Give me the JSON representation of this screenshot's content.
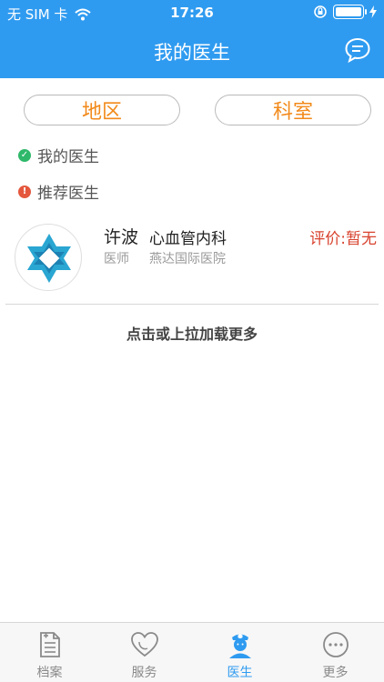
{
  "status": {
    "carrier": "无 SIM 卡",
    "time": "17:26"
  },
  "nav": {
    "title": "我的医生"
  },
  "filters": {
    "region": "地区",
    "department": "科室"
  },
  "sections": {
    "mine": "我的医生",
    "recommend": "推荐医生"
  },
  "doctor": {
    "name": "许波",
    "department": "心血管内科",
    "title": "医师",
    "hospital": "燕达国际医院",
    "rating": "评价:暂无"
  },
  "load_more": "点击或上拉加载更多",
  "tabs": [
    {
      "label": "档案",
      "icon": "document-icon"
    },
    {
      "label": "服务",
      "icon": "heart-icon"
    },
    {
      "label": "医生",
      "icon": "nurse-icon"
    },
    {
      "label": "更多",
      "icon": "more-icon"
    }
  ],
  "colors": {
    "primary": "#2f9bf0",
    "accent": "#f28a1b",
    "rating": "#d8432f"
  }
}
